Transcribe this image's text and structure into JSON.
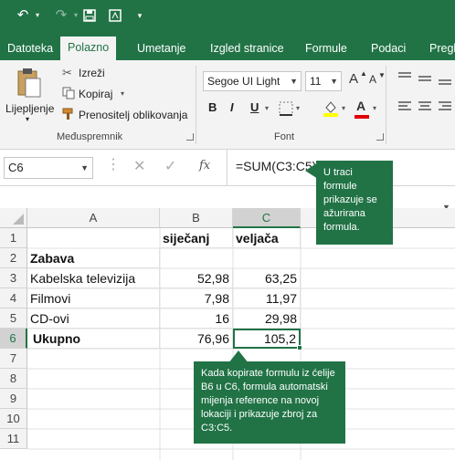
{
  "tabs": [
    "Datoteka",
    "Polazno",
    "Umetanje",
    "Izgled stranice",
    "Formule",
    "Podaci",
    "Pregl"
  ],
  "ribbon": {
    "paste_label": "Lijepljenje",
    "cut_label": "Izreži",
    "copy_label": "Kopiraj",
    "format_painter_label": "Prenositelj oblikovanja",
    "clipboard_group": "Međuspremnik",
    "font_name": "Segoe UI Light",
    "font_size": "11",
    "bold": "B",
    "italic": "I",
    "underline": "U",
    "font_color_glyph": "A",
    "grow_glyph": "A",
    "shrink_glyph": "A",
    "font_group": "Font"
  },
  "formula_bar": {
    "name_box": "C6",
    "formula": "=SUM(C3:C5)",
    "fx": "fx"
  },
  "columns": [
    "A",
    "B",
    "C"
  ],
  "rows": [
    "1",
    "2",
    "3",
    "4",
    "5",
    "6",
    "7",
    "8",
    "9",
    "10",
    "11"
  ],
  "cells": {
    "B1": "siječanj",
    "C1": "veljača",
    "A2": "Zabava",
    "A3": "Kabelska televizija",
    "B3": "52,98",
    "C3": "63,25",
    "A4": "Filmovi",
    "B4": "7,98",
    "C4": "11,97",
    "A5": "CD-ovi",
    "B5": "16",
    "C5": "29,98",
    "A6": "Ukupno",
    "B6": "76,96",
    "C6": "105,2"
  },
  "callouts": {
    "formula_callout": "U traci formule prikazuje se ažurirana formula.",
    "copy_callout": "Kada kopirate formulu iz ćelije B6 u C6, formula automatski mijenja reference na novoj lokaciji i prikazuje zbroj za C3:C5."
  },
  "colors": {
    "accent": "#217346"
  }
}
